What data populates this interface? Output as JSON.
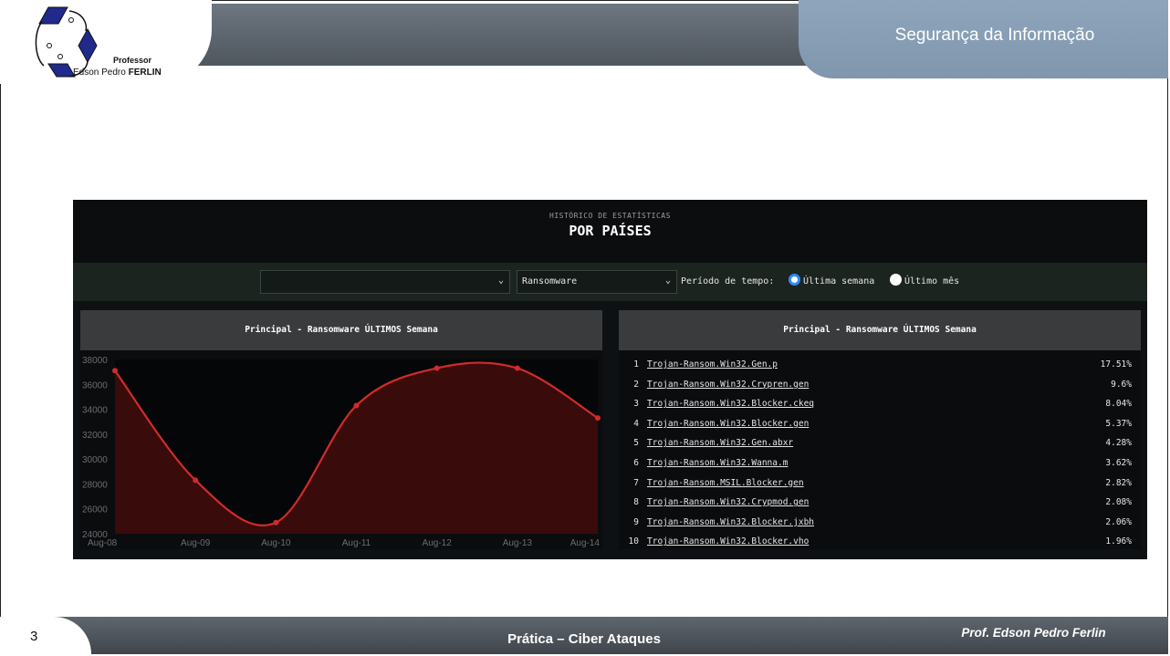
{
  "header": {
    "slide_title": "Segurança da Informação",
    "logo_professor": "Professor",
    "logo_name_first": "Edson Pedro ",
    "logo_name_last": "FERLIN"
  },
  "widget": {
    "subtitle": "HISTÓRICO DE ESTATÍSTICAS",
    "title": "POR PAÍSES",
    "filters": {
      "select1_value": "",
      "select2_value": "Ransomware",
      "period_label": "Período de tempo:",
      "options": [
        {
          "label": "Última semana",
          "selected": true
        },
        {
          "label": "Último mês",
          "selected": false
        }
      ]
    },
    "chart_panel_title": "Principal - Ransomware ÚLTIMOS Semana",
    "list_panel_title": "Principal - Ransomware ÚLTIMOS Semana",
    "top_list": [
      {
        "rank": "1",
        "name": "Trojan-Ransom.Win32.Gen.p",
        "percent": "17.51%"
      },
      {
        "rank": "2",
        "name": "Trojan-Ransom.Win32.Crypren.gen",
        "percent": "9.6%"
      },
      {
        "rank": "3",
        "name": "Trojan-Ransom.Win32.Blocker.ckeq",
        "percent": "8.04%"
      },
      {
        "rank": "4",
        "name": "Trojan-Ransom.Win32.Blocker.gen",
        "percent": "5.37%"
      },
      {
        "rank": "5",
        "name": "Trojan-Ransom.Win32.Gen.abxr",
        "percent": "4.28%"
      },
      {
        "rank": "6",
        "name": "Trojan-Ransom.Win32.Wanna.m",
        "percent": "3.62%"
      },
      {
        "rank": "7",
        "name": "Trojan-Ransom.MSIL.Blocker.gen",
        "percent": "2.82%"
      },
      {
        "rank": "8",
        "name": "Trojan-Ransom.Win32.Crypmod.gen",
        "percent": "2.08%"
      },
      {
        "rank": "9",
        "name": "Trojan-Ransom.Win32.Blocker.jxbh",
        "percent": "2.06%"
      },
      {
        "rank": "10",
        "name": "Trojan-Ransom.Win32.Blocker.vho",
        "percent": "1.96%"
      }
    ]
  },
  "chart_data": {
    "type": "area",
    "categories": [
      "Aug-08",
      "Aug-09",
      "Aug-10",
      "Aug-11",
      "Aug-12",
      "Aug-13",
      "Aug-14"
    ],
    "series": [
      {
        "values": [
          37100,
          28300,
          24900,
          34300,
          37300,
          37300,
          33300
        ]
      }
    ],
    "ylim": [
      24000,
      38000
    ],
    "yticks": [
      24000,
      26000,
      28000,
      30000,
      32000,
      34000,
      36000,
      38000
    ],
    "grid": false,
    "line_color": "#d02b2b",
    "fill_color": "#3a0b0b"
  },
  "footer": {
    "page_number": "3",
    "title": "Prática – Ciber Ataques",
    "author": "Prof. Edson Pedro Ferlin"
  }
}
